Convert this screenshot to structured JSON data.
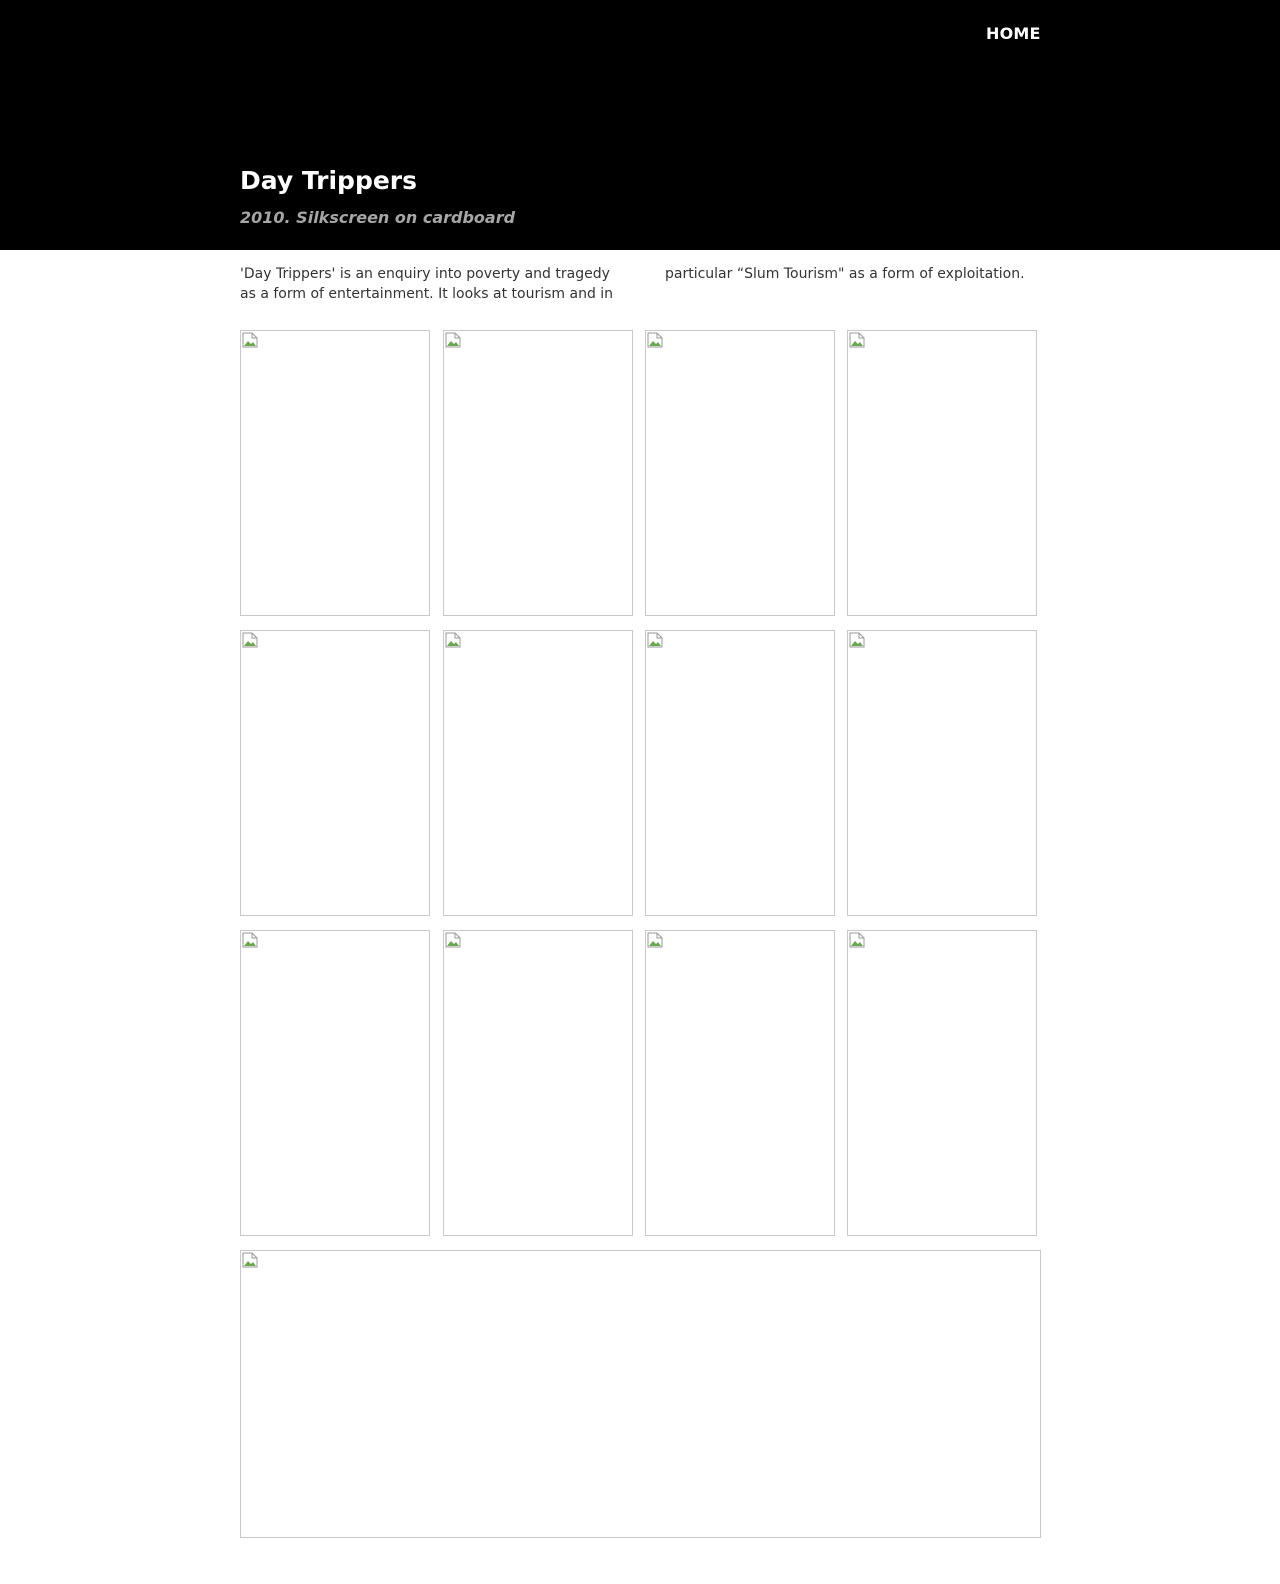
{
  "nav": {
    "home_label": "HOME"
  },
  "header": {
    "title": "Day Trippers",
    "subtitle": "2010. Silkscreen on cardboard"
  },
  "description": "'Day Trippers' is an enquiry into poverty and tragedy as a form of entertainment. It looks at tourism and in particular “Slum Tourism\" as a form of exploitation.",
  "gallery": {
    "image_count": 13,
    "icon": "broken-image-icon"
  },
  "colors": {
    "header_background": "#000000",
    "subtitle": "#a6a6a6",
    "body_text": "#333333",
    "thumb_border": "#c8c8c8"
  }
}
